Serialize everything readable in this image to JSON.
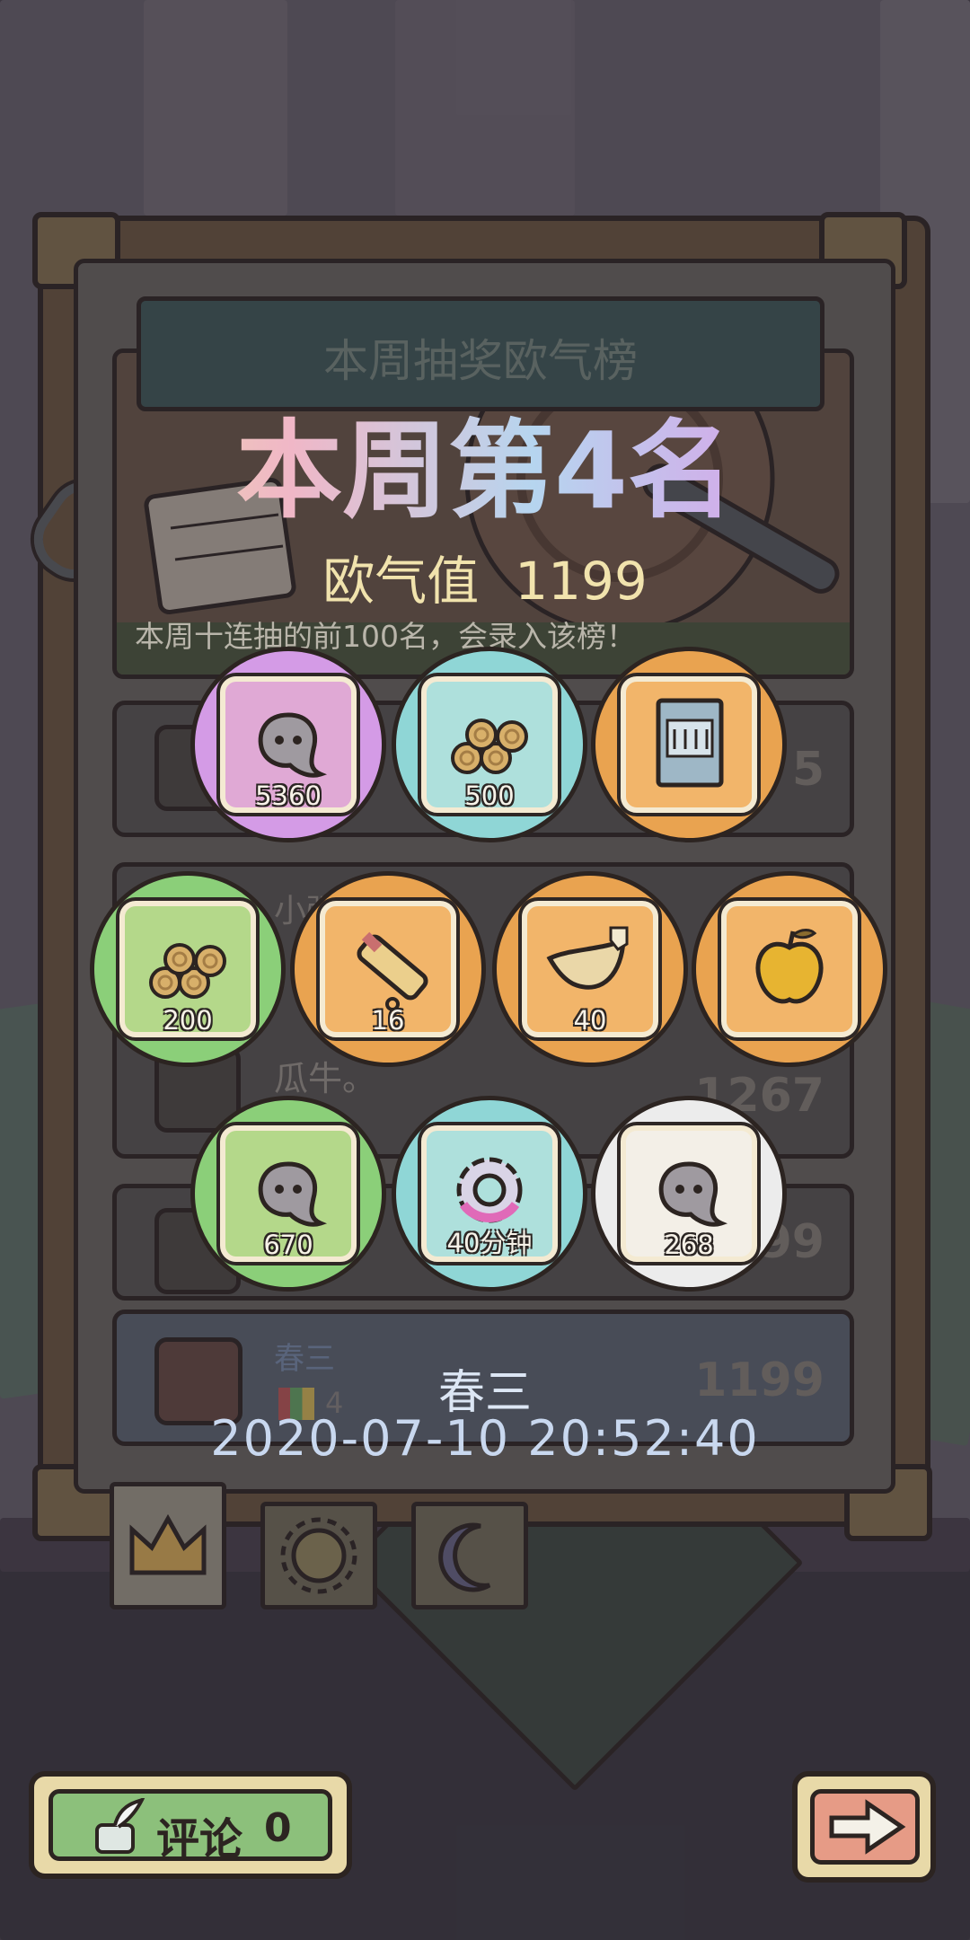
{
  "header": {
    "title": "本周抽奖欧气榜"
  },
  "result": {
    "rank_text": "本周第4名",
    "score_label": "欧气值",
    "score_value": "1199",
    "note": "本周十连抽的前100名，会录入该榜！"
  },
  "leaderboard": {
    "rows": [
      {
        "name": "",
        "score": "5"
      },
      {
        "name": "小强",
        "score": ""
      },
      {
        "name": "瓜牛。",
        "score": "1267"
      },
      {
        "name": "",
        "score": "99"
      }
    ],
    "me": {
      "name": "春三",
      "level": "4",
      "score": "1199"
    }
  },
  "rewards": [
    {
      "name": "ghost-token",
      "quantity": "5360",
      "rarity_color": "#d49be6",
      "tile_color": "#e0a9d5"
    },
    {
      "name": "wood-logs",
      "quantity": "500",
      "rarity_color": "#8fd6d6",
      "tile_color": "#aee0dc"
    },
    {
      "name": "music-book",
      "quantity": "",
      "rarity_color": "#e9a350",
      "tile_color": "#f2b56a"
    },
    {
      "name": "wood-logs",
      "quantity": "200",
      "rarity_color": "#8bcf79",
      "tile_color": "#b4d88a"
    },
    {
      "name": "telescope",
      "quantity": "16",
      "rarity_color": "#e9a350",
      "tile_color": "#f2b56a"
    },
    {
      "name": "horn",
      "quantity": "40",
      "rarity_color": "#e9a350",
      "tile_color": "#f2b56a"
    },
    {
      "name": "golden-apple",
      "quantity": "",
      "rarity_color": "#e9a350",
      "tile_color": "#f2b56a"
    },
    {
      "name": "ghost-token",
      "quantity": "670",
      "rarity_color": "#8bcf79",
      "tile_color": "#b4d88a"
    },
    {
      "name": "gear-speedup",
      "quantity": "40分钟",
      "rarity_color": "#8fd6d6",
      "tile_color": "#aee0dc"
    },
    {
      "name": "ghost-token",
      "quantity": "268",
      "rarity_color": "#ececec",
      "tile_color": "#f3efe7"
    }
  ],
  "winner": {
    "name": "春三",
    "timestamp": "2020-07-10 20:52:40"
  },
  "tabs": [
    "crown",
    "sun",
    "moon"
  ],
  "comment_button": {
    "label": "评论",
    "count": "0"
  },
  "next_button": {
    "icon": "arrow-right"
  }
}
